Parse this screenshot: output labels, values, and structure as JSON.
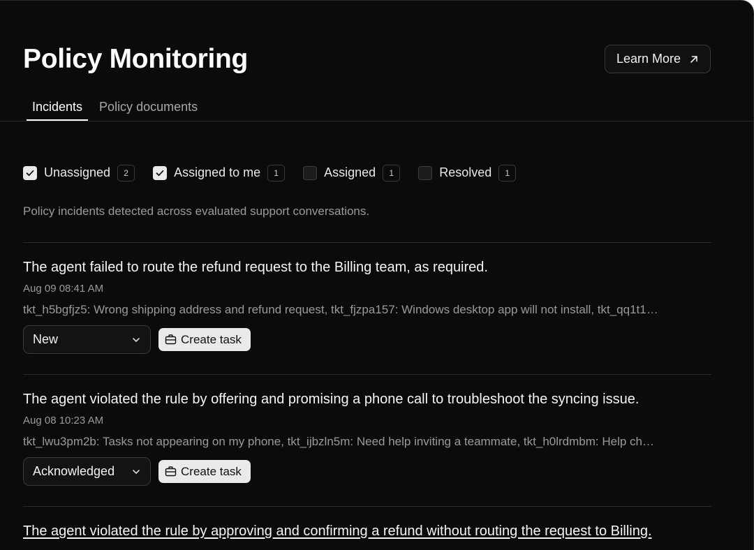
{
  "page": {
    "title": "Policy Monitoring",
    "learn_more_label": "Learn More",
    "description": "Policy incidents detected across evaluated support conversations."
  },
  "tabs": [
    {
      "label": "Incidents",
      "active": true
    },
    {
      "label": "Policy documents",
      "active": false
    }
  ],
  "filters": [
    {
      "label": "Unassigned",
      "count": "2",
      "checked": true
    },
    {
      "label": "Assigned to me",
      "count": "1",
      "checked": true
    },
    {
      "label": "Assigned",
      "count": "1",
      "checked": false
    },
    {
      "label": "Resolved",
      "count": "1",
      "checked": false
    }
  ],
  "incidents": [
    {
      "title": "The agent failed to route the refund request to the Billing team, as required.",
      "date": "Aug 09 08:41 AM",
      "tickets": "tkt_h5bgfjz5: Wrong shipping address and refund request, tkt_fjzpa157: Windows desktop app will not install, tkt_qq1t1…",
      "status": "New",
      "task_label": "Create task"
    },
    {
      "title": "The agent violated the rule by offering and promising a phone call to troubleshoot the syncing issue.",
      "date": "Aug 08 10:23 AM",
      "tickets": "tkt_lwu3pm2b: Tasks not appearing on my phone, tkt_ijbzln5m: Need help inviting a teammate, tkt_h0lrdmbm: Help ch…",
      "status": "Acknowledged",
      "task_label": "Create task"
    },
    {
      "title": "The agent violated the rule by approving and confirming a refund without routing the request to Billing."
    }
  ],
  "colors": {
    "background": "#0b0b0b",
    "text": "#f5f5f5",
    "muted": "#9a9a9a",
    "border": "#2a2a2a",
    "button_light": "#eaeaea"
  },
  "icons": {
    "learn_more": "arrow-up-right-icon",
    "select": "chevron-down-icon",
    "task": "briefcase-icon",
    "checkbox": "check-icon"
  }
}
